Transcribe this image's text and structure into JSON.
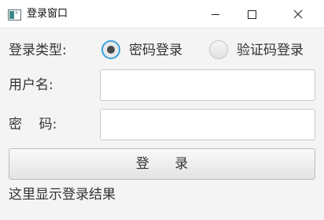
{
  "window": {
    "title": "登录窗口",
    "icon": "java-app-icon",
    "controls": [
      "minimize-icon",
      "maximize-icon",
      "close-icon"
    ]
  },
  "form": {
    "login_type_label": "登录类型:",
    "options": [
      {
        "label": "密码登录",
        "selected": true
      },
      {
        "label": "验证码登录",
        "selected": false
      }
    ],
    "username_label": "用户名:",
    "username_value": "",
    "password_label": "密    码:",
    "password_value": "",
    "login_button_label": "登      录",
    "result_text": "这里显示登录结果"
  },
  "colors": {
    "accent": "#3ba4dc",
    "background": "#f4f4f4",
    "titlebar": "#ffffff"
  }
}
